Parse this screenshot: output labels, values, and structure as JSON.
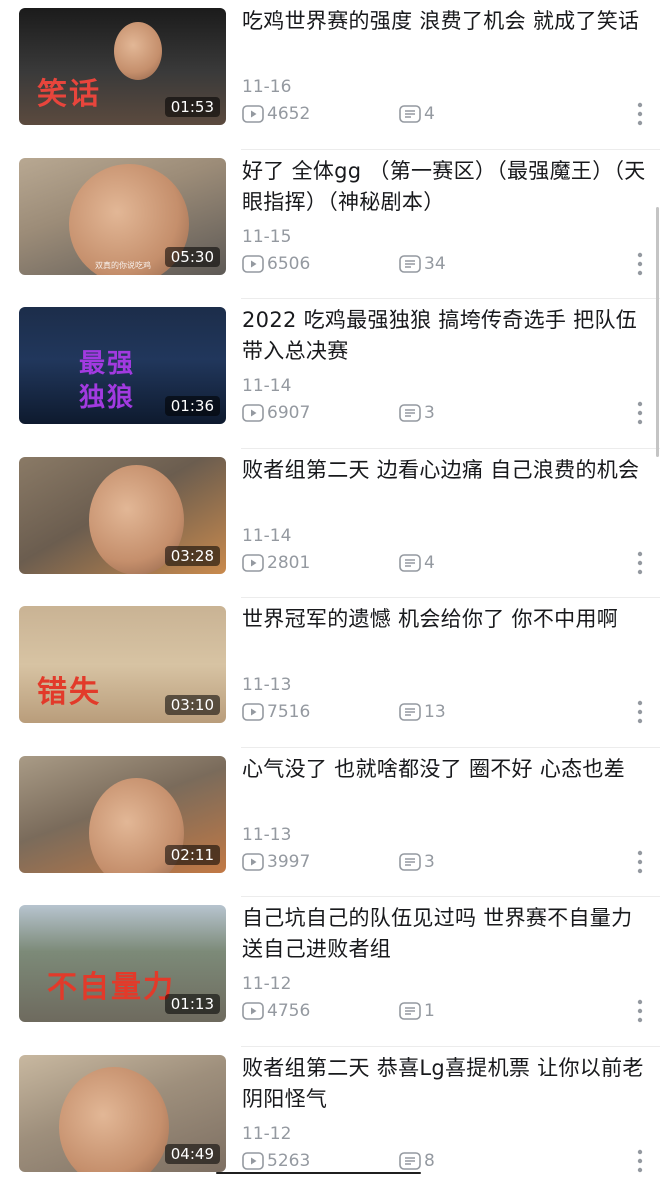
{
  "videos": [
    {
      "title": "吃鸡世界赛的强度 浪费了机会 就成了笑话",
      "date": "11-16",
      "plays": "4652",
      "comments": "4",
      "duration": "01:53",
      "overlay": "笑话",
      "overlay_color": "#e8453c",
      "scene": "t0"
    },
    {
      "title": "好了 全体gg （第一赛区）（最强魔王）（天眼指挥）（神秘剧本）",
      "date": "11-15",
      "plays": "6506",
      "comments": "34",
      "duration": "05:30",
      "overlay": "",
      "overlay_color": "",
      "caption": "双真的你说吃鸡",
      "scene": "t1"
    },
    {
      "title": "2022 吃鸡最强独狼 搞垮传奇选手 把队伍带入总决赛",
      "date": "11-14",
      "plays": "6907",
      "comments": "3",
      "duration": "01:36",
      "overlay": "最强\n独狼",
      "overlay_color": "#a23ae0",
      "scene": "t2"
    },
    {
      "title": "败者组第二天 边看心边痛 自己浪费的机会",
      "date": "11-14",
      "plays": "2801",
      "comments": "4",
      "duration": "03:28",
      "overlay": "",
      "overlay_color": "",
      "scene": "t3"
    },
    {
      "title": "世界冠军的遗憾 机会给你了 你不中用啊",
      "date": "11-13",
      "plays": "7516",
      "comments": "13",
      "duration": "03:10",
      "overlay": "错失",
      "overlay_color": "#e23a2a",
      "scene": "t4"
    },
    {
      "title": "心气没了 也就啥都没了 圈不好 心态也差",
      "date": "11-13",
      "plays": "3997",
      "comments": "3",
      "duration": "02:11",
      "overlay": "",
      "overlay_color": "",
      "scene": "t5"
    },
    {
      "title": "自己坑自己的队伍见过吗 世界赛不自量力送自己进败者组",
      "date": "11-12",
      "plays": "4756",
      "comments": "1",
      "duration": "01:13",
      "overlay": "不自量力",
      "overlay_color": "#e23a2a",
      "scene": "t6"
    },
    {
      "title": "败者组第二天 恭喜Lg喜提机票 让你以前老阴阳怪气",
      "date": "11-12",
      "plays": "5263",
      "comments": "8",
      "duration": "04:49",
      "overlay": "",
      "overlay_color": "",
      "scene": "t7"
    }
  ],
  "icons": {
    "play": "play-count-icon",
    "comment": "comment-count-icon",
    "more": "more-vertical-icon"
  },
  "colors": {
    "text_primary": "#18191c",
    "text_secondary": "#9499a0",
    "background": "#ffffff"
  }
}
